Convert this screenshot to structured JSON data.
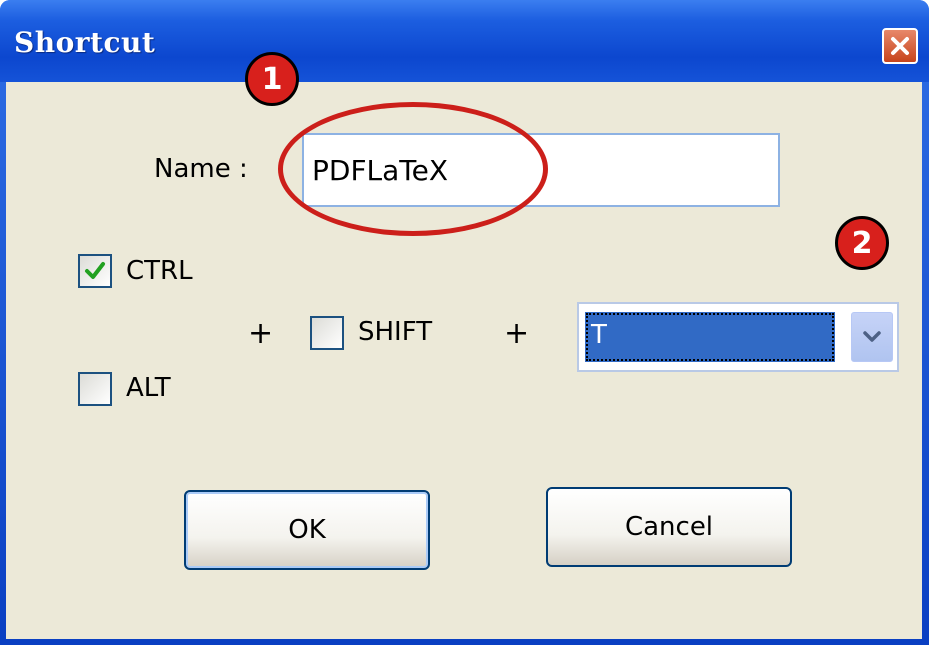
{
  "window": {
    "title": "Shortcut",
    "close_icon": "close-icon"
  },
  "form": {
    "name_label": "Name :",
    "name_value": "PDFLaTeX",
    "ctrl_label": "CTRL",
    "ctrl_checked": true,
    "alt_label": "ALT",
    "alt_checked": false,
    "shift_label": "SHIFT",
    "shift_checked": false,
    "plus_1": "+",
    "plus_2": "+",
    "key_value": "T"
  },
  "buttons": {
    "ok_label": "OK",
    "cancel_label": "Cancel"
  },
  "annotations": {
    "badge_1": "1",
    "badge_2": "2",
    "color": "#cc1f1a"
  }
}
